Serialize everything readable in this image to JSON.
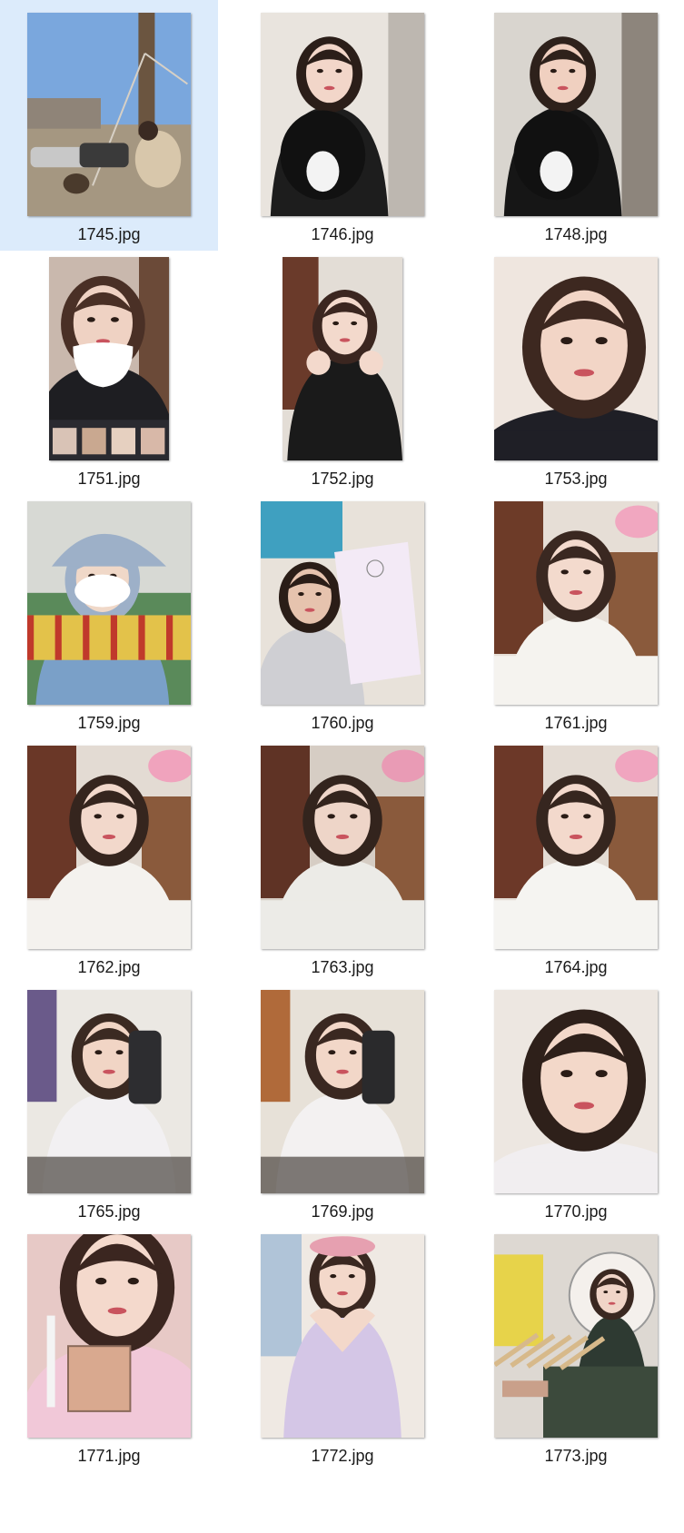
{
  "gallery": {
    "selected_index": 0,
    "items": [
      {
        "filename": "1745.jpg",
        "scene": "outdoor-street",
        "orientation": "portrait",
        "palette": {
          "bg": "#7aa7dd",
          "mid": "#b8a58f",
          "accent": "#2d2d2d",
          "skin": "#e9c9b4",
          "hair": "#3a2a22",
          "clothing": "#d8c7ab"
        }
      },
      {
        "filename": "1746.jpg",
        "scene": "selfie-with-puppy",
        "orientation": "portrait",
        "palette": {
          "bg": "#e9e4de",
          "mid": "#bdb7b0",
          "accent": "#111111",
          "skin": "#f2d6c9",
          "hair": "#2b1e19",
          "clothing": "#1d1d1d"
        }
      },
      {
        "filename": "1748.jpg",
        "scene": "selfie-with-puppy",
        "orientation": "portrait",
        "palette": {
          "bg": "#d9d5cf",
          "mid": "#8d857c",
          "accent": "#0f0f0f",
          "skin": "#f0d0c0",
          "hair": "#2e211b",
          "clothing": "#161616"
        }
      },
      {
        "filename": "1751.jpg",
        "scene": "masked-selfie",
        "orientation": "portrait-narrow",
        "palette": {
          "bg": "#c9b8ad",
          "mid": "#6b4a38",
          "accent": "#ffffff",
          "skin": "#efd2c3",
          "hair": "#4a3026",
          "clothing": "#1e1e22"
        }
      },
      {
        "filename": "1752.jpg",
        "scene": "selfie-hands",
        "orientation": "portrait-narrow",
        "palette": {
          "bg": "#e3ddd6",
          "mid": "#6a3a2a",
          "accent": "#f2a6c2",
          "skin": "#f3d9cc",
          "hair": "#3b2620",
          "clothing": "#1a1a1a"
        }
      },
      {
        "filename": "1753.jpg",
        "scene": "close-selfie",
        "orientation": "portrait",
        "palette": {
          "bg": "#efe6df",
          "mid": "#7a4636",
          "accent": "#ee9ab7",
          "skin": "#f2d5c6",
          "hair": "#3d2820",
          "clothing": "#1f1f26"
        }
      },
      {
        "filename": "1759.jpg",
        "scene": "winter-hat-mask",
        "orientation": "portrait",
        "palette": {
          "bg": "#d7d9d4",
          "mid": "#4a7c4a",
          "accent": "#e3c24a",
          "skin": "#f0d8c8",
          "hair": "#9db0c8",
          "clothing": "#7aa0c8"
        }
      },
      {
        "filename": "1760.jpg",
        "scene": "selfie-with-package",
        "orientation": "portrait",
        "palette": {
          "bg": "#e8e2da",
          "mid": "#3fa0c0",
          "accent": "#f3eaf6",
          "skin": "#e6c3ae",
          "hair": "#2a1d17",
          "clothing": "#cfcfd3"
        }
      },
      {
        "filename": "1761.jpg",
        "scene": "off-shoulder-selfie",
        "orientation": "portrait",
        "palette": {
          "bg": "#e6ded6",
          "mid": "#6d3b28",
          "accent": "#f1a7c0",
          "skin": "#f3dacd",
          "hair": "#3a2821",
          "clothing": "#f5f3ef"
        }
      },
      {
        "filename": "1762.jpg",
        "scene": "off-shoulder-selfie",
        "orientation": "portrait",
        "palette": {
          "bg": "#e3dbd3",
          "mid": "#6a3727",
          "accent": "#f0a3bd",
          "skin": "#f2d8cb",
          "hair": "#35251e",
          "clothing": "#f4f2ee"
        }
      },
      {
        "filename": "1763.jpg",
        "scene": "off-shoulder-selfie",
        "orientation": "portrait",
        "palette": {
          "bg": "#d6cdc4",
          "mid": "#5f3325",
          "accent": "#e99bb5",
          "skin": "#eed5c8",
          "hair": "#33241d",
          "clothing": "#ecebe7"
        }
      },
      {
        "filename": "1764.jpg",
        "scene": "off-shoulder-selfie",
        "orientation": "portrait",
        "palette": {
          "bg": "#e4dcd4",
          "mid": "#6c3828",
          "accent": "#f0a5bf",
          "skin": "#f3d9cc",
          "hair": "#36261f",
          "clothing": "#f5f4f1"
        }
      },
      {
        "filename": "1765.jpg",
        "scene": "mirror-selfie-phone",
        "orientation": "portrait",
        "palette": {
          "bg": "#ebe8e3",
          "mid": "#6a5a8a",
          "accent": "#2d2d30",
          "skin": "#f1d5c5",
          "hair": "#3b2a22",
          "clothing": "#f2f0f2"
        }
      },
      {
        "filename": "1769.jpg",
        "scene": "mirror-selfie-phone",
        "orientation": "portrait",
        "palette": {
          "bg": "#e7e1d8",
          "mid": "#b06a3a",
          "accent": "#2a2a2c",
          "skin": "#f2d7c8",
          "hair": "#3a2821",
          "clothing": "#f3f1f1"
        }
      },
      {
        "filename": "1770.jpg",
        "scene": "close-selfie",
        "orientation": "portrait",
        "palette": {
          "bg": "#ede7e1",
          "mid": "#8a6a5a",
          "accent": "#f4f1f2",
          "skin": "#f3d8c9",
          "hair": "#2e201a",
          "clothing": "#f1eef0"
        }
      },
      {
        "filename": "1771.jpg",
        "scene": "makeup-palette-selfie",
        "orientation": "portrait",
        "palette": {
          "bg": "#e7c9c6",
          "mid": "#c98f8a",
          "accent": "#d9a98f",
          "skin": "#f4d9cc",
          "hair": "#3b2620",
          "clothing": "#f1c8d8"
        }
      },
      {
        "filename": "1772.jpg",
        "scene": "heart-hands-selfie",
        "orientation": "portrait",
        "palette": {
          "bg": "#efe9e3",
          "mid": "#c8b8d8",
          "accent": "#e7a6b8",
          "skin": "#f3d8ca",
          "hair": "#3a2821",
          "clothing": "#d4c6e6"
        }
      },
      {
        "filename": "1773.jpg",
        "scene": "makeup-desk-mirror",
        "orientation": "portrait",
        "palette": {
          "bg": "#ddd8d2",
          "mid": "#3c4a3c",
          "accent": "#e7d34a",
          "skin": "#f0d5c8",
          "hair": "#3a2821",
          "clothing": "#2e3a32"
        }
      }
    ]
  }
}
